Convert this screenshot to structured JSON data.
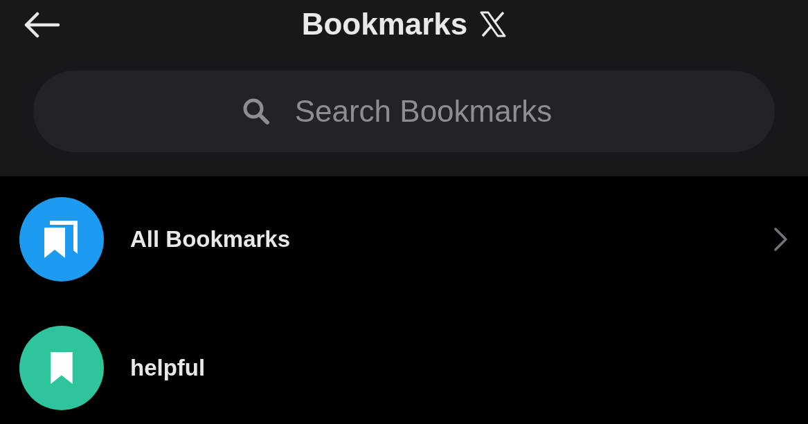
{
  "header": {
    "title": "Bookmarks"
  },
  "search": {
    "placeholder": "Search Bookmarks"
  },
  "folders": [
    {
      "label": "All Bookmarks",
      "kind": "all",
      "color": "#1d9bf0"
    },
    {
      "label": "helpful",
      "kind": "folder",
      "color": "#2fc59c"
    }
  ]
}
